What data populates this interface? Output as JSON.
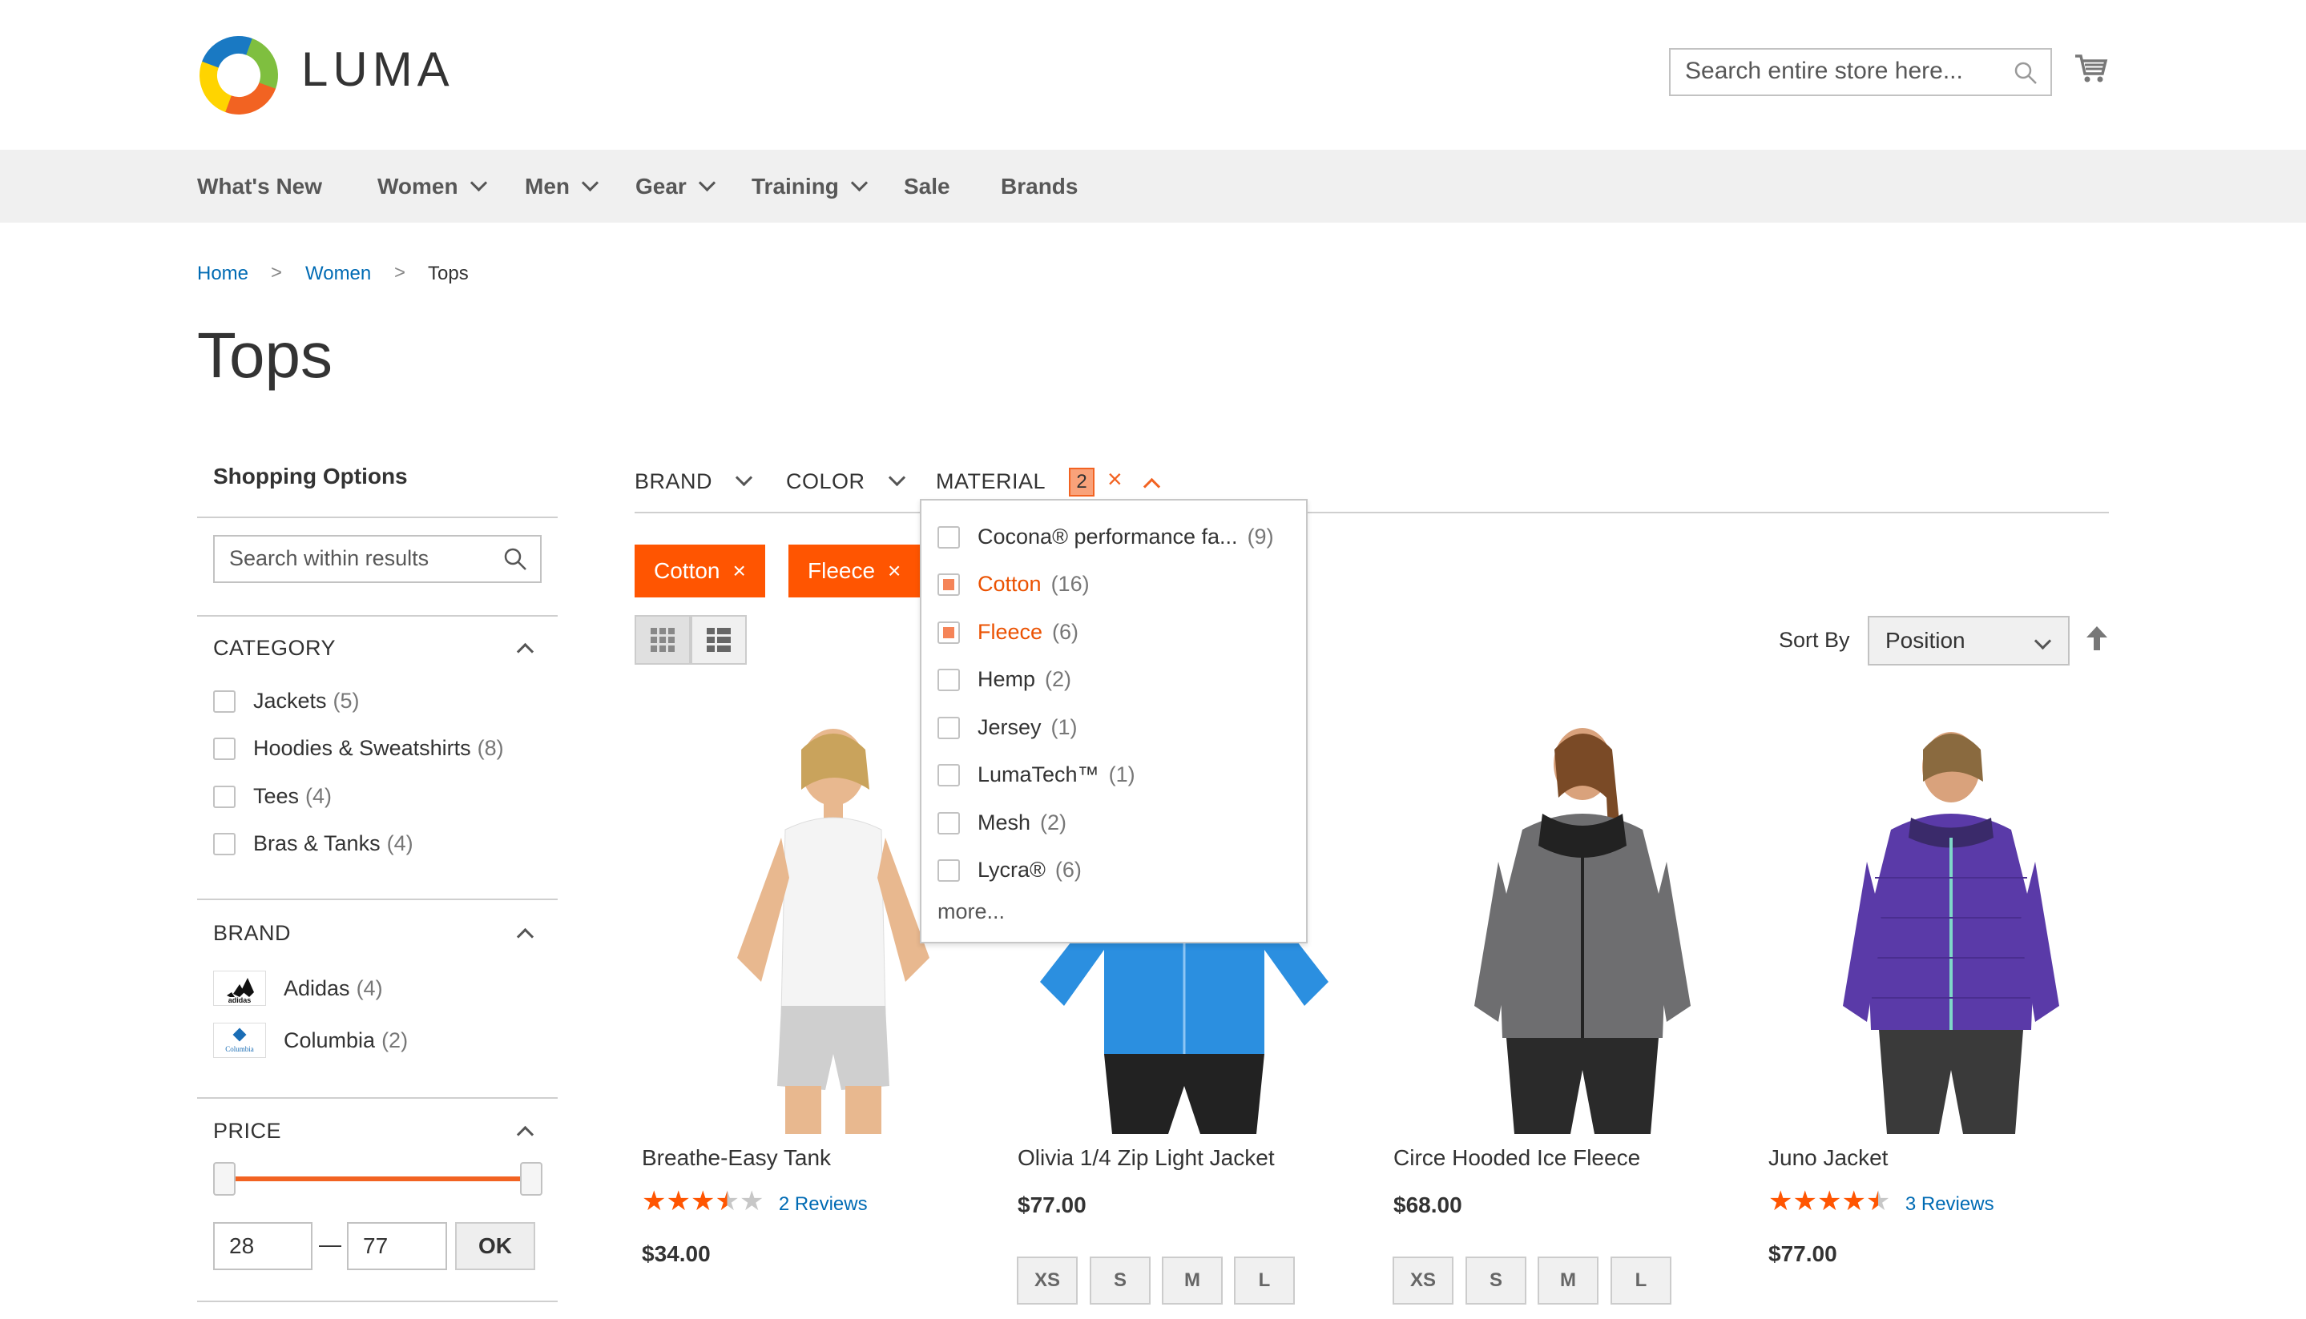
{
  "header": {
    "logo_text": "LUMA",
    "search_placeholder": "Search entire store here..."
  },
  "nav": {
    "items": [
      "What's New",
      "Women",
      "Men",
      "Gear",
      "Training",
      "Sale",
      "Brands"
    ]
  },
  "breadcrumb": {
    "items": [
      "Home",
      "Women",
      "Tops"
    ],
    "separator": ">"
  },
  "page_title": "Tops",
  "sidebar": {
    "title": "Shopping Options",
    "search_placeholder": "Search within results",
    "category": {
      "title": "CATEGORY",
      "items": [
        {
          "label": "Jackets",
          "count": "(5)"
        },
        {
          "label": "Hoodies & Sweatshirts",
          "count": "(8)"
        },
        {
          "label": "Tees",
          "count": "(4)"
        },
        {
          "label": "Bras & Tanks",
          "count": "(4)"
        }
      ]
    },
    "brand": {
      "title": "BRAND",
      "items": [
        {
          "label": "Adidas",
          "count": "(4)",
          "logo": "adidas"
        },
        {
          "label": "Columbia",
          "count": "(2)",
          "logo": "Columbia"
        }
      ]
    },
    "price": {
      "title": "PRICE",
      "min": "28",
      "max": "77",
      "dash": "—",
      "ok_label": "OK"
    }
  },
  "filters": {
    "brand_label": "BRAND",
    "color_label": "COLOR",
    "material_label": "MATERIAL",
    "material_count": "2",
    "clear_symbol": "×",
    "chips": [
      {
        "label": "Cotton",
        "remove": "×"
      },
      {
        "label": "Fleece",
        "remove": "×"
      }
    ]
  },
  "material_dropdown": {
    "options": [
      {
        "label": "Cocona® performance fa...",
        "count": "(9)",
        "selected": false
      },
      {
        "label": "Cotton",
        "count": "(16)",
        "selected": true
      },
      {
        "label": "Fleece",
        "count": "(6)",
        "selected": true
      },
      {
        "label": "Hemp",
        "count": "(2)",
        "selected": false
      },
      {
        "label": "Jersey",
        "count": "(1)",
        "selected": false
      },
      {
        "label": "LumaTech™",
        "count": "(1)",
        "selected": false
      },
      {
        "label": "Mesh",
        "count": "(2)",
        "selected": false
      },
      {
        "label": "Lycra®",
        "count": "(6)",
        "selected": false
      }
    ],
    "more_label": "more..."
  },
  "toolbar": {
    "sort_label": "Sort By",
    "sort_value": "Position"
  },
  "products": [
    {
      "name": "Breathe-Easy Tank",
      "rating": 3.5,
      "reviews": "2  Reviews",
      "price": "$34.00"
    },
    {
      "name": "Olivia 1/4 Zip Light Jacket",
      "price": "$77.00",
      "sizes": [
        "XS",
        "S",
        "M",
        "L"
      ]
    },
    {
      "name": "Circe Hooded Ice Fleece",
      "price": "$68.00",
      "sizes": [
        "XS",
        "S",
        "M",
        "L"
      ]
    },
    {
      "name": "Juno Jacket",
      "rating": 4.5,
      "reviews": "3  Reviews",
      "price": "$77.00"
    }
  ],
  "colors": {
    "accent": "#ff5501",
    "link": "#006bb4",
    "nav_bg": "#f0f0f0"
  }
}
